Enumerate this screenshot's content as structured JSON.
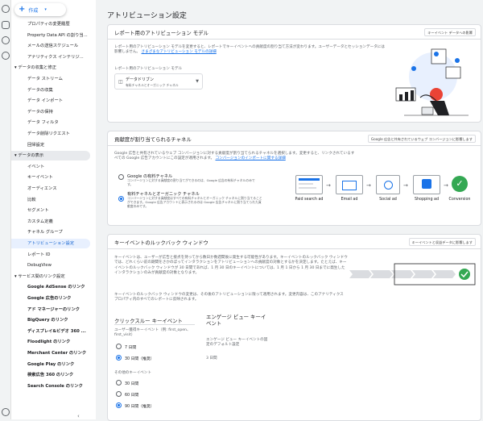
{
  "header": {
    "create_label": "作成"
  },
  "sidebar": {
    "items": [
      {
        "label": "プロパティの変更履歴",
        "indent": true
      },
      {
        "label": "Property Data API の割り当...",
        "indent": true
      },
      {
        "label": "メールの送信スケジュール",
        "indent": true
      },
      {
        "label": "アナリティクス インテリジ...",
        "indent": true
      },
      {
        "label": "データの収集と修正",
        "group": true
      },
      {
        "label": "データ ストリーム",
        "indent": true
      },
      {
        "label": "データの収集",
        "indent": true
      },
      {
        "label": "データ インポート",
        "indent": true
      },
      {
        "label": "データの保持",
        "indent": true
      },
      {
        "label": "データ フィルタ",
        "indent": true
      },
      {
        "label": "データ削除リクエスト",
        "indent": true
      },
      {
        "label": "回帰設定",
        "indent": true
      },
      {
        "label": "データの表示",
        "group": true,
        "hl": true
      },
      {
        "label": "イベント",
        "indent": true
      },
      {
        "label": "キーイベント",
        "indent": true
      },
      {
        "label": "オーディエンス",
        "indent": true
      },
      {
        "label": "比較",
        "indent": true
      },
      {
        "label": "セグメント",
        "indent": true
      },
      {
        "label": "カスタム定義",
        "indent": true
      },
      {
        "label": "チャネル グループ",
        "indent": true
      },
      {
        "label": "アトリビューション設定",
        "indent": true,
        "selected": true
      },
      {
        "label": "レポート ID",
        "indent": true
      },
      {
        "label": "DebugView",
        "indent": true
      },
      {
        "label": "サービス間のリンク設定",
        "group": true
      },
      {
        "label": "Google AdSense のリンク",
        "indent": true,
        "link": true
      },
      {
        "label": "Google 広告のリンク",
        "indent": true,
        "link": true
      },
      {
        "label": "アド マネージャーのリンク",
        "indent": true,
        "link": true
      },
      {
        "label": "BigQuery のリンク",
        "indent": true,
        "link": true
      },
      {
        "label": "ディスプレイ&ビデオ 360 ...",
        "indent": true,
        "link": true
      },
      {
        "label": "Floodlight のリンク",
        "indent": true,
        "link": true
      },
      {
        "label": "Merchant Center のリンク",
        "indent": true,
        "link": true
      },
      {
        "label": "Google Play のリンク",
        "indent": true,
        "link": true
      },
      {
        "label": "検索広告 360 のリンク",
        "indent": true,
        "link": true
      },
      {
        "label": "Search Console のリンク",
        "indent": true,
        "link": true
      }
    ],
    "collapse_icon": "chevron-left-icon"
  },
  "page": {
    "title": "アトリビューション設定"
  },
  "report_model": {
    "title": "レポート用のアトリビューション モデル",
    "button": "キーイベント データへの影響",
    "desc": "レポート用のアトリビューション モデルを変更すると、レポートでキーイベントへの貢献度の割り当て方法が変わります。ユーザーデータとセッションデータには影響しません。",
    "link": "さまざまなアトリビューション モデルの詳細",
    "field_label": "レポート用のアトリビューション モデル",
    "selected_value": "データドリブン",
    "selected_sub": "有料チャネルとオーガニック チャネル"
  },
  "channels": {
    "title": "貢献度が割り当てられるチャネル",
    "button": "Google 広告と共有されているウェブ コンバージョンに影響します",
    "desc": "Google 広告と共有されているウェブ コンバージョンに対する貢献度が割り当てられるチャネルを選択します。変更すると、リンクされているすべての Google 広告アカウントにこの設定が適用されます。",
    "link": "コンバージョンのインポートに関する詳細",
    "option1_title": "Google の有料チャネル",
    "option1_desc": "コンバージョンに対する貢献度の割り当てができるのは、Google 広告の有料チャネルのみです。",
    "option2_title": "有料チャネルとオーガニック チャネル",
    "option2_desc": "コンバージョンに対する貢献度はすべての有料チャネルとオーガニック チャネルに割り当てることができます。Google 広告アカウントに表示されるのは Google 広告チャネルに割り当てられた貢献度のみです。",
    "steps": [
      "Paid search ad",
      "Email ad",
      "Social ad",
      "Shopping ad",
      "Conversion"
    ]
  },
  "lookback": {
    "title": "キーイベントのルックバック ウィンドウ",
    "button": "キーイベントと収益データに影響します",
    "desc1": "キーイベントは、ユーザーが広告と接点を持ってから数日か数週間後に発生する可能性があります。キーイベントのルックバック ウィンドウでは、どれくらい前の期間をさかのぼってインタラクションをアトリビューションへの貢献度の対象とするかを決定します。たとえば、キーイベントのルックバック ウィンドウが 30 日間であれば、1 月 30 日のキーイベントについては、1 月 1 日から 1 月 30 日までに発生したインタラクションのみが貢献度の対象となります。",
    "desc2": "キーイベントのルックバック ウィンドウの変更は、その後のアトリビューションに限って適用されます。変更内容は、このアナリティクス プロパティ内のすべてのレポートに反映されます。",
    "col1_title": "クリックスルー キーイベント",
    "col1_sub": "ユーザー獲得キーイベント（例: first_open、first_visit）",
    "col1_opts": [
      {
        "label": "7 日間",
        "on": false
      },
      {
        "label": "30 日間（推奨）",
        "on": true
      }
    ],
    "col1_sub2": "その他のキーイベント",
    "col1_opts2": [
      {
        "label": "30 日間",
        "on": false
      },
      {
        "label": "60 日間",
        "on": false
      },
      {
        "label": "90 日間（推奨）",
        "on": true
      }
    ],
    "col2_title": "エンゲージ ビュー キーイベント",
    "col2_sub": "エンゲージ ビュー キーイベントの固定のデフォルト設定",
    "col2_value": "3 日間"
  },
  "colors": {
    "accent": "#1a73e8",
    "selected_bg": "#e8f0fe",
    "success": "#34a853"
  }
}
